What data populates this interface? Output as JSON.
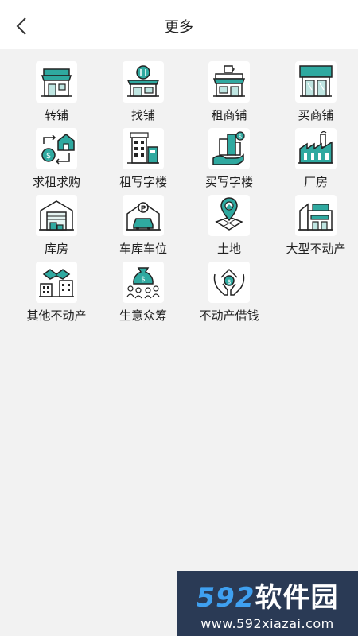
{
  "header": {
    "title": "更多"
  },
  "colors": {
    "accent": "#2fa9a0",
    "ink": "#222222"
  },
  "items": [
    {
      "label": "转铺",
      "icon": "shop-front-icon"
    },
    {
      "label": "找铺",
      "icon": "restaurant-shop-icon"
    },
    {
      "label": "租商铺",
      "icon": "cafe-shop-icon"
    },
    {
      "label": "买商铺",
      "icon": "supermarket-icon"
    },
    {
      "label": "求租求购",
      "icon": "house-money-exchange-icon"
    },
    {
      "label": "租写字楼",
      "icon": "office-building-icon"
    },
    {
      "label": "买写字楼",
      "icon": "hand-buildings-icon"
    },
    {
      "label": "厂房",
      "icon": "factory-icon"
    },
    {
      "label": "库房",
      "icon": "warehouse-icon"
    },
    {
      "label": "车库车位",
      "icon": "garage-parking-icon"
    },
    {
      "label": "土地",
      "icon": "land-location-icon"
    },
    {
      "label": "大型不动产",
      "icon": "mall-icon"
    },
    {
      "label": "其他不动产",
      "icon": "handshake-buildings-icon"
    },
    {
      "label": "生意众筹",
      "icon": "crowdfunding-icon"
    },
    {
      "label": "不动产借钱",
      "icon": "hands-house-money-icon"
    }
  ],
  "watermark": {
    "top_num": "592",
    "top_text": "软件园",
    "url": "www.592xiazai.com"
  }
}
